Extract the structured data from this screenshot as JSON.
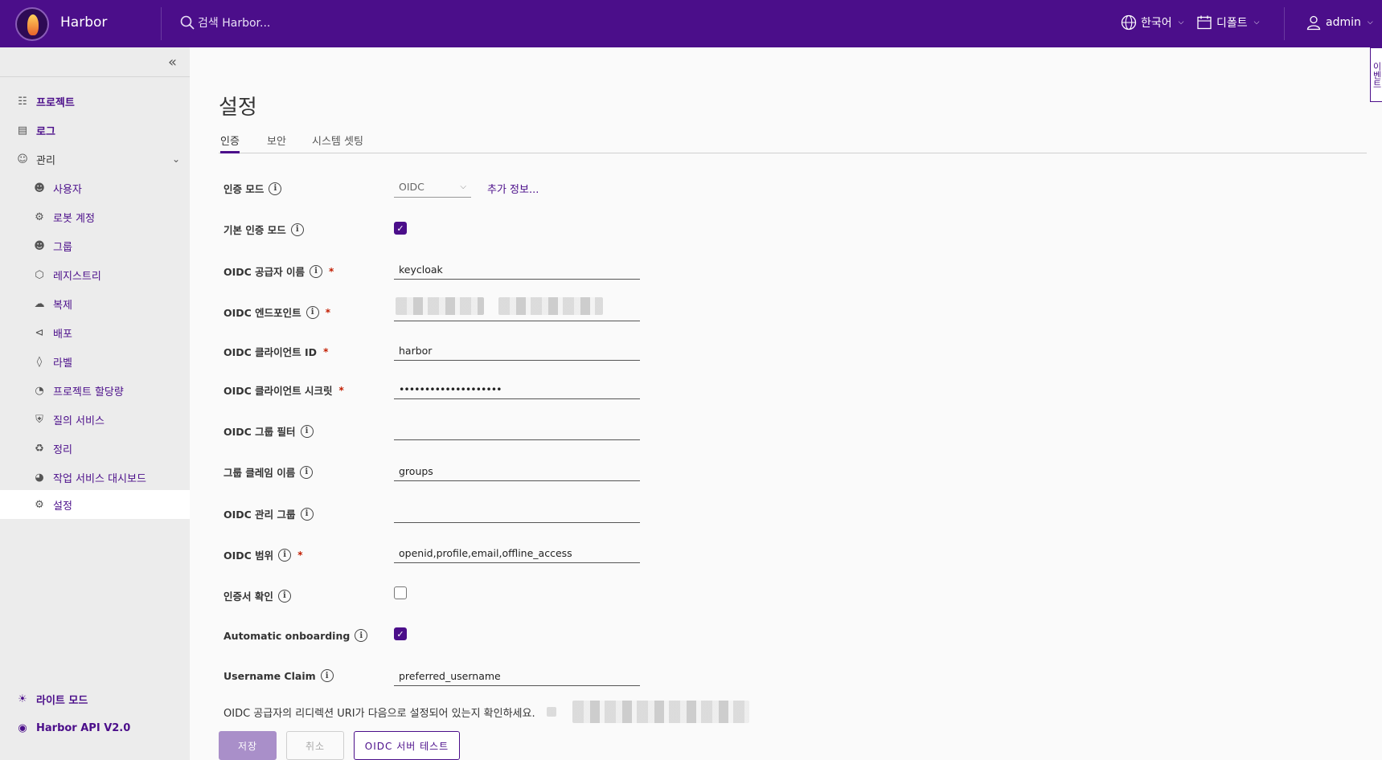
{
  "header": {
    "app_title": "Harbor",
    "search_placeholder": "검색 Harbor...",
    "language": "한국어",
    "datetime_format": "디폴트",
    "user": "admin",
    "accent_color": "#4b0e8a"
  },
  "sidebar": {
    "items": [
      {
        "label": "프로젝트",
        "icon": "projects-icon"
      },
      {
        "label": "로그",
        "icon": "logs-icon"
      },
      {
        "label": "관리",
        "icon": "admin-icon"
      }
    ],
    "admin_items": [
      {
        "label": "사용자",
        "icon": "users-icon"
      },
      {
        "label": "로봇 계정",
        "icon": "robot-icon"
      },
      {
        "label": "그룹",
        "icon": "groups-icon"
      },
      {
        "label": "레지스트리",
        "icon": "registry-icon"
      },
      {
        "label": "복제",
        "icon": "replication-icon"
      },
      {
        "label": "배포",
        "icon": "distribution-icon"
      },
      {
        "label": "라벨",
        "icon": "label-icon"
      },
      {
        "label": "프로젝트 할당량",
        "icon": "quota-icon"
      },
      {
        "label": "질의 서비스",
        "icon": "interrogation-icon"
      },
      {
        "label": "정리",
        "icon": "clean-up-icon"
      },
      {
        "label": "작업 서비스 대시보드",
        "icon": "dashboard-icon"
      },
      {
        "label": "설정",
        "icon": "settings-icon"
      }
    ],
    "footer": {
      "theme": "라이트 모드",
      "api": "Harbor API V2.0"
    }
  },
  "main": {
    "title": "설정",
    "tabs": [
      "인증",
      "보안",
      "시스템 셋팅"
    ],
    "auth_mode": {
      "label": "인증 모드",
      "value": "OIDC",
      "link": "추가 정보..."
    },
    "primary_auth": {
      "label": "기본 인증 모드",
      "checked": true
    },
    "oidc_provider": {
      "label": "OIDC 공급자 이름",
      "value": "keycloak"
    },
    "oidc_endpoint": {
      "label": "OIDC 엔드포인트"
    },
    "oidc_client_id": {
      "label": "OIDC 클라이언트 ID",
      "value": "harbor"
    },
    "oidc_client_secret": {
      "label": "OIDC 클라이언트 시크릿",
      "value": "••••••••••••••••••••"
    },
    "oidc_group_filter": {
      "label": "OIDC 그룹 필터",
      "value": ""
    },
    "group_claim": {
      "label": "그룹 클레임 이름",
      "value": "groups"
    },
    "oidc_admin_group": {
      "label": "OIDC 관리 그룹",
      "value": ""
    },
    "oidc_scope": {
      "label": "OIDC 범위",
      "value": "openid,profile,email,offline_access"
    },
    "verify_cert": {
      "label": "인증서 확인",
      "checked": false
    },
    "auto_onboarding": {
      "label": "Automatic onboarding",
      "checked": true
    },
    "username_claim": {
      "label": "Username Claim",
      "value": "preferred_username"
    },
    "redirect_note": "OIDC 공급자의 리디렉션 URI가 다음으로 설정되어 있는지 확인하세요.",
    "buttons": {
      "save": "저장",
      "cancel": "취소",
      "test": "OIDC 서버 테스트"
    },
    "side_tab": "이벤트"
  }
}
